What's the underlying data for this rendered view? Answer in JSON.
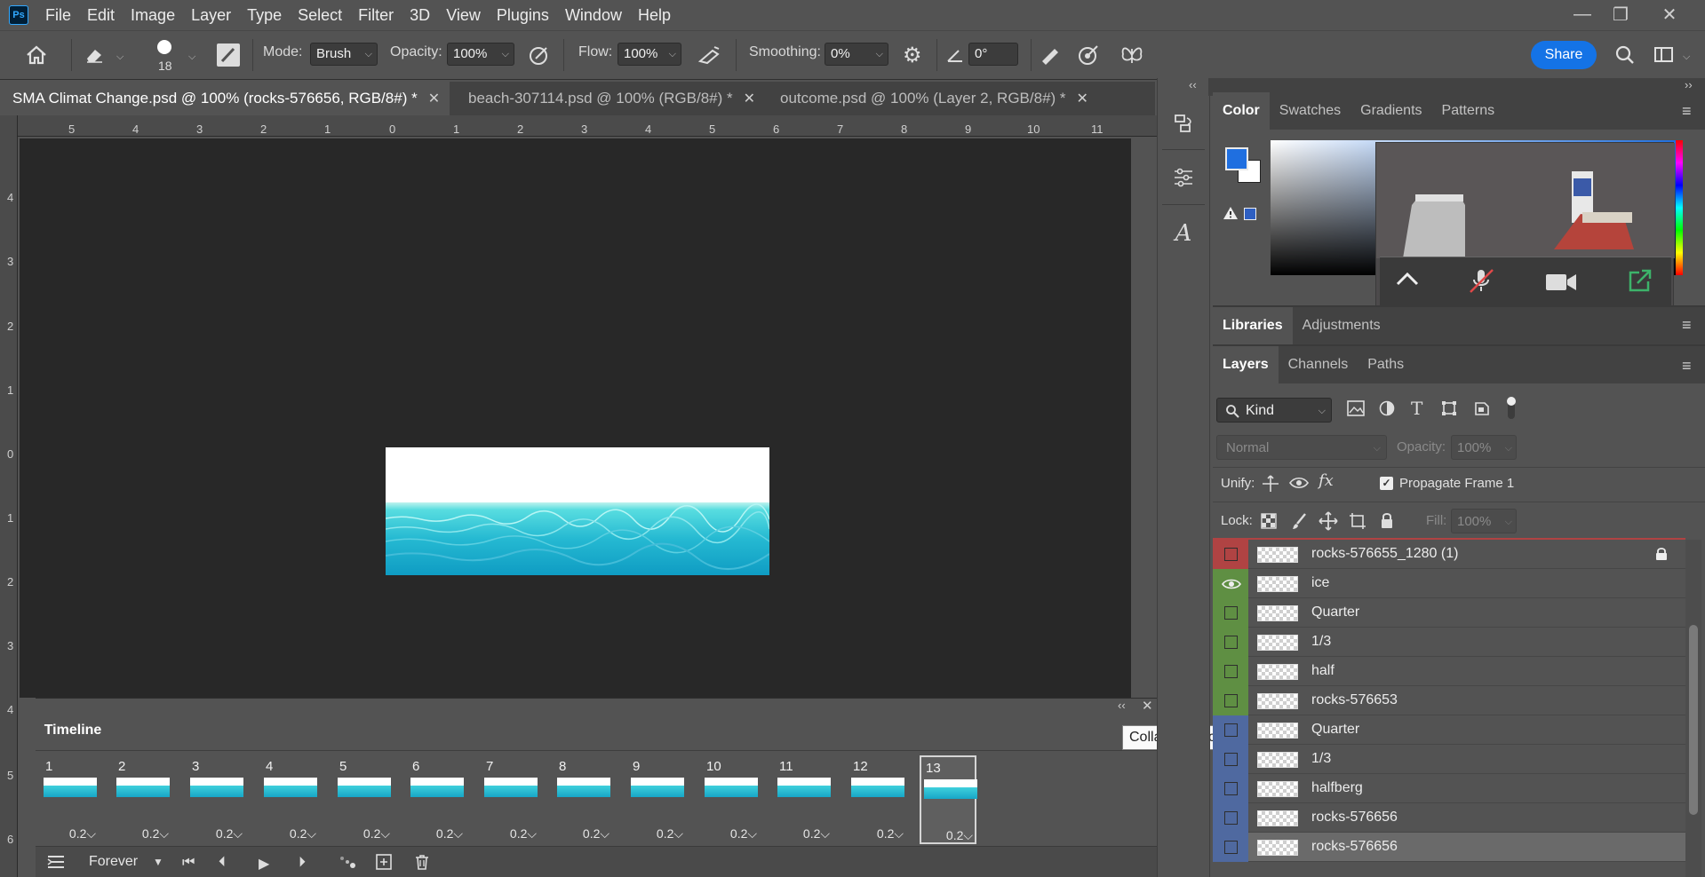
{
  "app": {
    "logo_text": "Ps"
  },
  "menu": [
    "File",
    "Edit",
    "Image",
    "Layer",
    "Type",
    "Select",
    "Filter",
    "3D",
    "View",
    "Plugins",
    "Window",
    "Help"
  ],
  "options_bar": {
    "brush_size": "18",
    "mode_label": "Mode:",
    "mode_value": "Brush",
    "opacity_label": "Opacity:",
    "opacity_value": "100%",
    "flow_label": "Flow:",
    "flow_value": "100%",
    "smoothing_label": "Smoothing:",
    "smoothing_value": "0%",
    "angle_value": "0°",
    "share_label": "Share",
    "share_color": "#1473e6"
  },
  "tabs": [
    {
      "label": "SMA Climat Change.psd @ 100% (rocks-576656, RGB/8#) *",
      "active": true
    },
    {
      "label": "beach-307114.psd @ 100% (RGB/8#) *",
      "active": false
    },
    {
      "label": "outcome.psd @ 100% (Layer 2, RGB/8#) *",
      "active": false
    }
  ],
  "ruler_h": [
    "5",
    "4",
    "3",
    "2",
    "1",
    "0",
    "1",
    "2",
    "3",
    "4",
    "5",
    "6",
    "7",
    "8",
    "9",
    "10",
    "11"
  ],
  "ruler_v": [
    "4",
    "3",
    "2",
    "1",
    "0",
    "1",
    "2",
    "3",
    "4",
    "5",
    "6"
  ],
  "color_panel": {
    "tabs": [
      "Color",
      "Swatches",
      "Gradients",
      "Patterns"
    ],
    "foreground": "#1f6fe0",
    "background": "#ffffff"
  },
  "libraries_panel": {
    "tabs": [
      "Libraries",
      "Adjustments"
    ]
  },
  "layers_panel": {
    "tabs": [
      "Layers",
      "Channels",
      "Paths"
    ],
    "filter_label": "Kind",
    "blend_mode": "Normal",
    "opacity_label": "Opacity:",
    "opacity_value": "100%",
    "unify_label": "Unify:",
    "propagate_label": "Propagate Frame 1",
    "lock_label": "Lock:",
    "fill_label": "Fill:",
    "fill_value": "100%",
    "layers": [
      {
        "name": "rocks-576655_1280 (1)",
        "color": "#b04343",
        "visible": false,
        "locked": true,
        "selected": false
      },
      {
        "name": "ice",
        "color": "#5f8f43",
        "visible": true,
        "locked": false,
        "selected": false
      },
      {
        "name": "Quarter",
        "color": "#5f8f43",
        "visible": false,
        "locked": false,
        "selected": false
      },
      {
        "name": "1/3",
        "color": "#5f8f43",
        "visible": false,
        "locked": false,
        "selected": false
      },
      {
        "name": "half",
        "color": "#5f8f43",
        "visible": false,
        "locked": false,
        "selected": false
      },
      {
        "name": "rocks-576653",
        "color": "#5f8f43",
        "visible": false,
        "locked": false,
        "selected": false
      },
      {
        "name": "Quarter",
        "color": "#4f69a0",
        "visible": false,
        "locked": false,
        "selected": false
      },
      {
        "name": "1/3",
        "color": "#4f69a0",
        "visible": false,
        "locked": false,
        "selected": false
      },
      {
        "name": "halfberg",
        "color": "#4f69a0",
        "visible": false,
        "locked": false,
        "selected": false
      },
      {
        "name": "rocks-576656",
        "color": "#4f69a0",
        "visible": false,
        "locked": false,
        "selected": false
      },
      {
        "name": "rocks-576656",
        "color": "#4f69a0",
        "visible": false,
        "locked": false,
        "selected": true
      }
    ]
  },
  "timeline": {
    "title": "Timeline",
    "frames": [
      {
        "num": "1",
        "delay": "0.2"
      },
      {
        "num": "2",
        "delay": "0.2"
      },
      {
        "num": "3",
        "delay": "0.2"
      },
      {
        "num": "4",
        "delay": "0.2"
      },
      {
        "num": "5",
        "delay": "0.2"
      },
      {
        "num": "6",
        "delay": "0.2"
      },
      {
        "num": "7",
        "delay": "0.2"
      },
      {
        "num": "8",
        "delay": "0.2"
      },
      {
        "num": "9",
        "delay": "0.2"
      },
      {
        "num": "10",
        "delay": "0.2"
      },
      {
        "num": "11",
        "delay": "0.2"
      },
      {
        "num": "12",
        "delay": "0.2"
      },
      {
        "num": "13",
        "delay": "0.2",
        "active": true
      }
    ],
    "loop_value": "Forever"
  },
  "tooltip": "Collapse to Icons"
}
